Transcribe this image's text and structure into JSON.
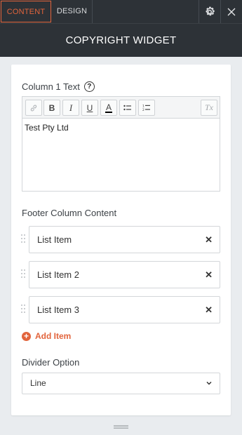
{
  "tabs": {
    "content": "CONTENT",
    "design": "DESIGN"
  },
  "icons": {
    "settings": "gear-icon",
    "close": "close-icon"
  },
  "header": {
    "title": "COPYRIGHT WIDGET"
  },
  "column1": {
    "label": "Column 1 Text",
    "help": "?",
    "toolbar": {
      "link": "link-icon",
      "bold": "B",
      "italic": "I",
      "underline": "U",
      "text_color": "A",
      "bullet_list": "bulleted-list-icon",
      "numbered_list": "numbered-list-icon",
      "clear_format": "Tx"
    },
    "text": "Test Pty Ltd"
  },
  "footer_column": {
    "label": "Footer Column Content",
    "items": [
      {
        "label": "List Item",
        "remove": "✕"
      },
      {
        "label": "List Item 2",
        "remove": "✕"
      },
      {
        "label": "List Item 3",
        "remove": "✕"
      }
    ],
    "add_label": "Add Item"
  },
  "divider": {
    "label": "Divider Option",
    "value": "Line"
  },
  "colors": {
    "accent": "#e2643c",
    "header_bg": "#2d3237",
    "panel_bg": "#e9ecef"
  }
}
